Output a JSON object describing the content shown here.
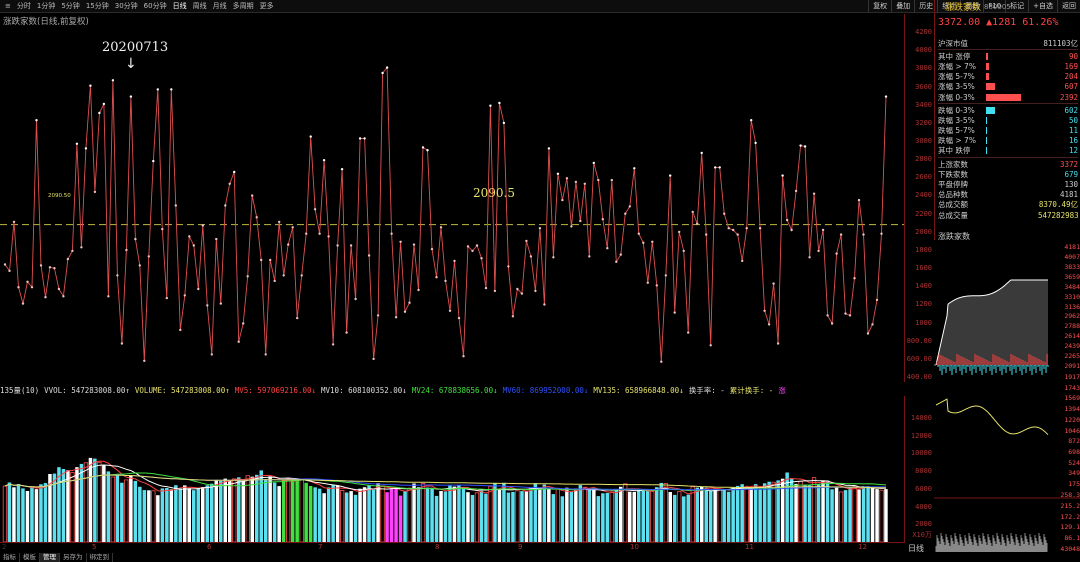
{
  "toolbar": {
    "periods": [
      "分时",
      "1分钟",
      "5分钟",
      "15分钟",
      "30分钟",
      "60分钟",
      "日线",
      "周线",
      "月线",
      "多周期",
      "更多"
    ],
    "active": "日线",
    "buttons": [
      "复权",
      "叠加",
      "历史",
      "统计",
      "画线",
      "F10",
      "标记",
      "+自选",
      "返回"
    ]
  },
  "main": {
    "title": "涨跌家数(日线,前复权)",
    "annotation_date": "20200713",
    "average_label": "2090.5",
    "average_small": "2090.50",
    "y_labels": [
      "4200",
      "4000",
      "3800",
      "3600",
      "3400",
      "3200",
      "3000",
      "2800",
      "2600",
      "2400",
      "2200",
      "2000",
      "1800",
      "1600",
      "1400",
      "1200",
      "1000",
      "800.00",
      "600.00",
      "400.00"
    ]
  },
  "indicator": {
    "prefix": "135量(10)",
    "items": [
      {
        "text": "VVOL: 547283008.00↑",
        "color": "#dddddd"
      },
      {
        "text": "VOLUME: 547283008.00↑",
        "color": "#e6e26a"
      },
      {
        "text": "MV5: 597069216.00↓",
        "color": "#ff4040"
      },
      {
        "text": "MV10: 608100352.00↓",
        "color": "#dddddd"
      },
      {
        "text": "MV24: 678838656.00↓",
        "color": "#40e040"
      },
      {
        "text": "MV60: 869952000.00↓",
        "color": "#3050ff"
      },
      {
        "text": "MV135: 658966848.00↓",
        "color": "#e6e26a"
      },
      {
        "text": "换手率: -",
        "color": "#dddddd"
      },
      {
        "text": "累计换手: -",
        "color": "#e6e26a"
      },
      {
        "text": "涨",
        "color": "#ff40ff"
      }
    ]
  },
  "volume_axis": [
    "14000",
    "12000",
    "10000",
    "8000",
    "6000",
    "4000",
    "2000",
    "X10万"
  ],
  "xaxis": [
    "5",
    "6",
    "7",
    "8",
    "9",
    "10",
    "11",
    "12",
    "2"
  ],
  "bottom_tabs": [
    "指标",
    "模板",
    "管理",
    "另存为",
    "绑定到"
  ],
  "mode_label": "日线",
  "right_panel": {
    "name": "涨跌家数",
    "code": "880005",
    "price": "3372.00",
    "change": "▲1281",
    "pct": "61.26%",
    "rows": [
      {
        "label": "沪深市值",
        "value": "811103亿",
        "color": "#ccc",
        "bar": 0
      },
      {
        "label": "其中 涨停",
        "value": "90",
        "color": "#ff5050",
        "bar": 3
      },
      {
        "label": "涨幅 > 7%",
        "value": "169",
        "color": "#ff5050",
        "bar": 5
      },
      {
        "label": "涨幅 5-7%",
        "value": "204",
        "color": "#ff5050",
        "bar": 6
      },
      {
        "label": "涨幅 3-5%",
        "value": "607",
        "color": "#ff5050",
        "bar": 17
      },
      {
        "label": "涨幅 0-3%",
        "value": "2392",
        "color": "#ff5050",
        "bar": 68
      },
      {
        "label": "跌幅 0-3%",
        "value": "602",
        "color": "#40e0f0",
        "bar": 17
      },
      {
        "label": "跌幅 3-5%",
        "value": "50",
        "color": "#40e0f0",
        "bar": 1
      },
      {
        "label": "跌幅 5-7%",
        "value": "11",
        "color": "#40e0f0",
        "bar": 1
      },
      {
        "label": "跌幅 > 7%",
        "value": "16",
        "color": "#40e0f0",
        "bar": 1
      },
      {
        "label": "其中 跌停",
        "value": "12",
        "color": "#40e0f0",
        "bar": 1
      },
      {
        "label": "上涨家数",
        "value": "3372",
        "color": "#ff5050",
        "bar": 0
      },
      {
        "label": "下跌家数",
        "value": "679",
        "color": "#40e0f0",
        "bar": 0
      },
      {
        "label": "平盘停牌",
        "value": "130",
        "color": "#ccc",
        "bar": 0
      },
      {
        "label": "总品种数",
        "value": "4181",
        "color": "#ccc",
        "bar": 0
      },
      {
        "label": "总成交额",
        "value": "8370.49亿",
        "color": "#e6e26a",
        "bar": 0
      },
      {
        "label": "总成交量",
        "value": "547282983",
        "color": "#e6e26a",
        "bar": 0
      }
    ],
    "sub_title": "涨跌家数",
    "mini_axis_top": [
      "4181",
      "4007",
      "3833",
      "3659",
      "3484",
      "3310",
      "3136",
      "2962",
      "2788",
      "2614",
      "2439",
      "2265",
      "2091"
    ],
    "mini_axis_mid": [
      "1917",
      "1743",
      "1569",
      "1394",
      "1220",
      "1046",
      "872",
      "698",
      "524",
      "349",
      "175"
    ],
    "mini_axis_bot": [
      "258.3",
      "215.2",
      "172.2",
      "129.1",
      "86.1",
      "43048"
    ]
  },
  "chart_data": {
    "type": "line",
    "title": "涨跌家数(日线,前复权)",
    "ylim": [
      400,
      4300
    ],
    "average": 2090.5,
    "values": [
      1650,
      1580,
      2120,
      1400,
      1220,
      1460,
      1400,
      3240,
      1640,
      1290,
      1620,
      1610,
      1380,
      1300,
      1710,
      1800,
      2980,
      1840,
      2930,
      3620,
      2450,
      3320,
      3420,
      1300,
      3680,
      1530,
      780,
      1810,
      3500,
      1930,
      1640,
      590,
      1740,
      2790,
      3580,
      2040,
      1280,
      3580,
      2300,
      930,
      1310,
      1960,
      1860,
      1380,
      2080,
      1200,
      660,
      1930,
      1220,
      2300,
      2540,
      2670,
      800,
      1000,
      1520,
      2410,
      2170,
      1700,
      660,
      1700,
      1470,
      2120,
      1530,
      1870,
      2060,
      1060,
      1530,
      1990,
      3060,
      2260,
      1990,
      2800,
      1960,
      770,
      1860,
      2700,
      900,
      1860,
      1270,
      3040,
      3040,
      1750,
      610,
      1090,
      3760,
      3820,
      1990,
      1070,
      1900,
      1130,
      1230,
      1870,
      1370,
      2940,
      2910,
      1820,
      1510,
      2060,
      1470,
      1140,
      1690,
      1060,
      640,
      1850,
      1800,
      1860,
      1720,
      1390,
      3400,
      1360,
      3430,
      3210,
      1630,
      1080,
      1380,
      1330,
      1910,
      1740,
      1360,
      2050,
      1210,
      2930,
      1730,
      2650,
      2360,
      2600,
      2070,
      2560,
      2130,
      2540,
      1740,
      2770,
      2580,
      2150,
      1830,
      2580,
      1680,
      1760,
      2210,
      2290,
      2710,
      1990,
      1890,
      1450,
      1900,
      1420,
      580,
      1530,
      2630,
      1120,
      2010,
      1800,
      900,
      2230,
      2100,
      2880,
      1980,
      760,
      2720,
      2720,
      2210,
      2050,
      2030,
      1980,
      1690,
      2050,
      3240,
      2990,
      2050,
      1140,
      990,
      1440,
      780,
      2630,
      2140,
      2030,
      2460,
      2960,
      2950,
      1730,
      2430,
      1800,
      2030,
      1090,
      1000,
      1770,
      1980,
      1110,
      1090,
      1500,
      2360,
      1980,
      890,
      990,
      1260,
      1990,
      3500
    ]
  }
}
